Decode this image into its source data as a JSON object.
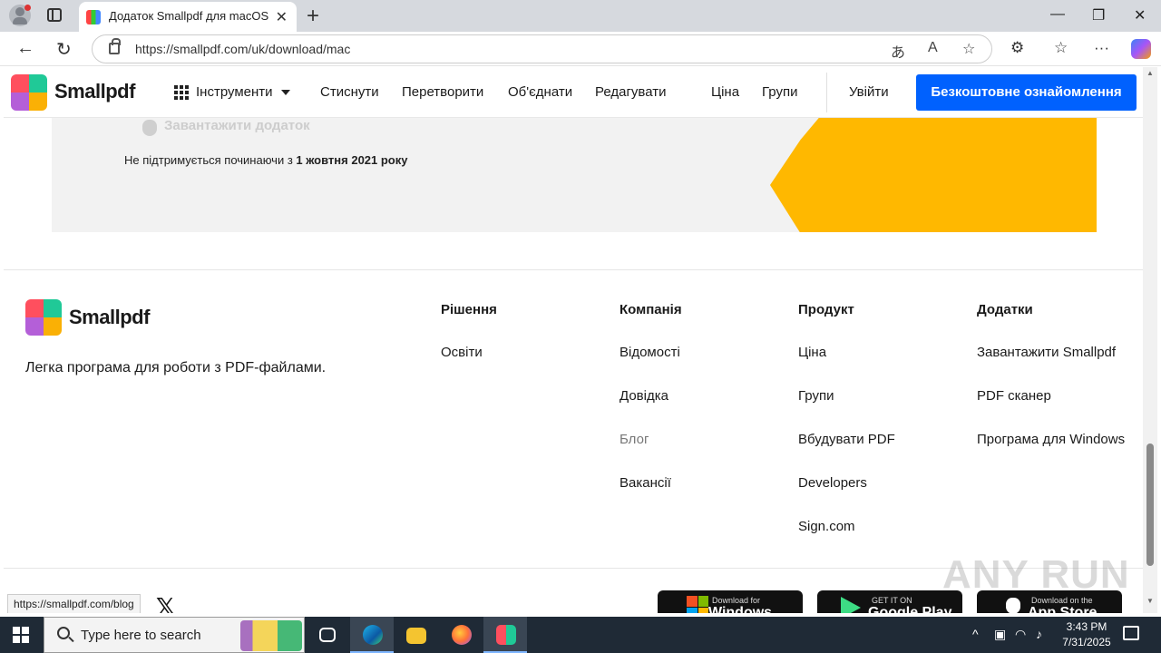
{
  "browser": {
    "tab_title": "Додаток Smallpdf для macOS",
    "url": "https://smallpdf.com/uk/download/mac",
    "status_url": "https://smallpdf.com/blog"
  },
  "header": {
    "logo_text": "Smallpdf",
    "tools_label": "Інструменти",
    "nav": [
      "Стиснути",
      "Перетворити",
      "Об'єднати",
      "Редагувати",
      "Ціна",
      "Групи"
    ],
    "login": "Увійти",
    "cta": "Безкоштовне ознайомлення"
  },
  "hero": {
    "download_app": "Завантажити додаток",
    "unsupported_prefix": "Не підтримується починаючи з",
    "unsupported_date": "1 жовтня 2021 року"
  },
  "footer": {
    "logo_text": "Smallpdf",
    "tagline": "Легка програма для роботи з PDF-файлами.",
    "columns": [
      {
        "title": "Рішення",
        "links": [
          "Освіти"
        ]
      },
      {
        "title": "Компанія",
        "links": [
          "Відомості",
          "Довідка",
          "Блог",
          "Вакансії"
        ]
      },
      {
        "title": "Продукт",
        "links": [
          "Ціна",
          "Групи",
          "Вбудувати PDF",
          "Developers",
          "Sign.com"
        ]
      },
      {
        "title": "Додатки",
        "links": [
          "Завантажити Smallpdf",
          "PDF сканер",
          "Програма для Windows"
        ]
      }
    ],
    "stores": [
      {
        "small": "Download for",
        "big": "Windows"
      },
      {
        "small": "GET IT ON",
        "big": "Google Play"
      },
      {
        "small": "Download on the",
        "big": "App Store"
      }
    ],
    "x_icon": "𝕏"
  },
  "watermark": "ANY RUN",
  "taskbar": {
    "search_placeholder": "Type here to search",
    "time": "3:43 PM",
    "date": "7/31/2025"
  },
  "colors": {
    "cta_blue": "#0061fe",
    "yellow": "#ffb800",
    "logo": [
      "#ff4f5e",
      "#20c997",
      "#4c6ef5",
      "#fab005"
    ]
  }
}
